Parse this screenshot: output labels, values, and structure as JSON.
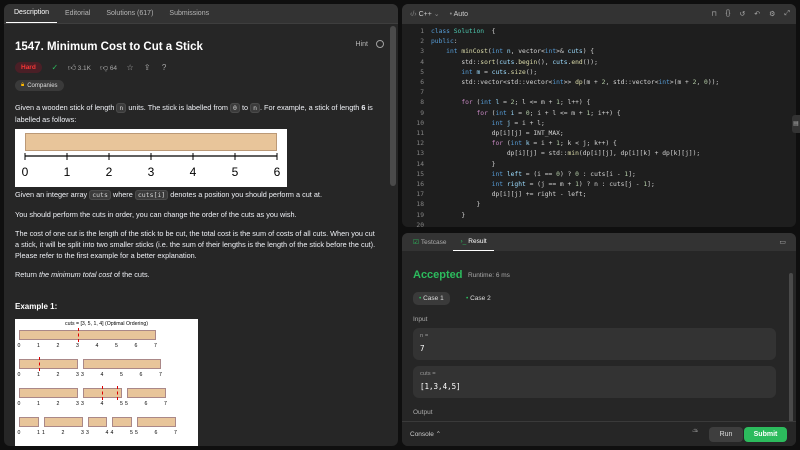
{
  "tabs": [
    "Description",
    "Editorial",
    "Solutions (617)",
    "Submissions"
  ],
  "problem": {
    "title": "1547. Minimum Cost to Cut a Stick",
    "hint": "Hint",
    "difficulty": "Hard",
    "likes": "3.1K",
    "dislikes": "64",
    "companies": "Companies",
    "p1a": "Given a wooden stick of length ",
    "p1n": "n",
    "p1b": " units. The stick is labelled from ",
    "p1z": "0",
    "p1c": " to ",
    "p1n2": "n",
    "p1d": ". For example, a stick of length ",
    "p1six": "6",
    "p1e": " is labelled as follows:",
    "p2a": "Given an integer array ",
    "p2cuts": "cuts",
    "p2b": " where ",
    "p2ci": "cuts[i]",
    "p2c": " denotes a position you should perform a cut at.",
    "p3": "You should perform the cuts in order, you can change the order of the cuts as you wish.",
    "p4": "The cost of one cut is the length of the stick to be cut, the total cost is the sum of costs of all cuts. When you cut a stick, it will be split into two smaller sticks (i.e. the sum of their lengths is the length of the stick before the cut). Please refer to the first example for a better explanation.",
    "p5a": "Return ",
    "p5b": "the minimum total cost",
    "p5c": " of the cuts.",
    "example": "Example 1:",
    "stick_labels": [
      "0",
      "1",
      "2",
      "3",
      "4",
      "5",
      "6"
    ],
    "ex_caption": "cuts = [3, 5, 1, 4] (Optimal Ordering)",
    "ex_labels": [
      "0",
      "1",
      "2",
      "3",
      "4",
      "5",
      "6",
      "7"
    ]
  },
  "editor": {
    "language": "C++",
    "mode": "Auto",
    "lines": [
      [
        [
          "kw",
          "class "
        ],
        [
          "ty",
          "Solution"
        ],
        [
          "",
          "  {"
        ]
      ],
      [
        [
          "kw",
          "public"
        ],
        [
          "",
          ":"
        ]
      ],
      [
        [
          "",
          "    "
        ],
        [
          "kw",
          "int "
        ],
        [
          "fn",
          "minCost"
        ],
        [
          "",
          "("
        ],
        [
          "kw",
          "int "
        ],
        [
          "vr",
          "n"
        ],
        [
          "",
          ", vector<"
        ],
        [
          "kw",
          "int"
        ],
        [
          "",
          ">& "
        ],
        [
          "vr",
          "cuts"
        ],
        [
          "",
          ") {"
        ]
      ],
      [
        [
          "",
          "        std::"
        ],
        [
          "fn",
          "sort"
        ],
        [
          "",
          "("
        ],
        [
          "vr",
          "cuts"
        ],
        [
          "",
          "."
        ],
        [
          "fn",
          "begin"
        ],
        [
          "",
          "(), "
        ],
        [
          "vr",
          "cuts"
        ],
        [
          "",
          "."
        ],
        [
          "fn",
          "end"
        ],
        [
          "",
          "());"
        ]
      ],
      [
        [
          "",
          "        "
        ],
        [
          "kw",
          "int "
        ],
        [
          "vr",
          "m"
        ],
        [
          "",
          " = "
        ],
        [
          "vr",
          "cuts"
        ],
        [
          "",
          "."
        ],
        [
          "fn",
          "size"
        ],
        [
          "",
          "();"
        ]
      ],
      [
        [
          "",
          "        std::vector<std::vector<"
        ],
        [
          "kw",
          "int"
        ],
        [
          "",
          ">> "
        ],
        [
          "fn",
          "dp"
        ],
        [
          "",
          "(m + "
        ],
        [
          "nm",
          "2"
        ],
        [
          "",
          ", std::vector<"
        ],
        [
          "kw",
          "int"
        ],
        [
          "",
          ">(m + "
        ],
        [
          "nm",
          "2"
        ],
        [
          "",
          ", "
        ],
        [
          "nm",
          "0"
        ],
        [
          "",
          "));"
        ]
      ],
      [
        [
          "",
          ""
        ]
      ],
      [
        [
          "",
          "        "
        ],
        [
          "ct",
          "for "
        ],
        [
          "",
          "("
        ],
        [
          "kw",
          "int "
        ],
        [
          "vr",
          "l"
        ],
        [
          "",
          "",
          " = "
        ],
        [
          "nm",
          "2"
        ],
        [
          "",
          "; l <= m + "
        ],
        [
          "nm",
          "1"
        ],
        [
          "",
          "; l++) {"
        ]
      ],
      [
        [
          "",
          "            "
        ],
        [
          "ct",
          "for "
        ],
        [
          "",
          "("
        ],
        [
          "kw",
          "int "
        ],
        [
          "vr",
          "i"
        ],
        [
          "",
          "",
          " = "
        ],
        [
          "nm",
          "0"
        ],
        [
          "",
          "; i + l <= m + "
        ],
        [
          "nm",
          "1"
        ],
        [
          "",
          "; i++) {"
        ]
      ],
      [
        [
          "",
          "                "
        ],
        [
          "kw",
          "int "
        ],
        [
          "vr",
          "j"
        ],
        [
          "",
          "",
          " = i + l;"
        ]
      ],
      [
        [
          "",
          "                dp[i][j] = INT_MAX;"
        ]
      ],
      [
        [
          "",
          "                "
        ],
        [
          "ct",
          "for "
        ],
        [
          "",
          "("
        ],
        [
          "kw",
          "int "
        ],
        [
          "vr",
          "k"
        ],
        [
          "",
          "",
          " = i + "
        ],
        [
          "nm",
          "1"
        ],
        [
          "",
          "; k < j; k++) {"
        ]
      ],
      [
        [
          "",
          "                    dp[i][j] = std::"
        ],
        [
          "fn",
          "min"
        ],
        [
          "",
          "(dp[i][j], dp[i][k] + dp[k][j]);"
        ]
      ],
      [
        [
          "",
          "                }"
        ]
      ],
      [
        [
          "",
          "                "
        ],
        [
          "kw",
          "int "
        ],
        [
          "vr",
          "left"
        ],
        [
          "",
          "",
          " = (i == "
        ],
        [
          "nm",
          "0"
        ],
        [
          "",
          ") ? "
        ],
        [
          "nm",
          "0"
        ],
        [
          "",
          " : cuts[i - "
        ],
        [
          "nm",
          "1"
        ],
        [
          "",
          "];"
        ]
      ],
      [
        [
          "",
          "                "
        ],
        [
          "kw",
          "int "
        ],
        [
          "vr",
          "right"
        ],
        [
          "",
          "",
          " = (j == m + "
        ],
        [
          "nm",
          "1"
        ],
        [
          "",
          ") ? n : cuts[j - "
        ],
        [
          "nm",
          "1"
        ],
        [
          "",
          "];"
        ]
      ],
      [
        [
          "",
          "                dp[i][j] += right - left;"
        ]
      ],
      [
        [
          "",
          "            }"
        ]
      ],
      [
        [
          "",
          "        }"
        ]
      ],
      [
        [
          "",
          ""
        ]
      ],
      [
        [
          "",
          "        "
        ],
        [
          "ct",
          "return "
        ],
        [
          "",
          "dp["
        ],
        [
          "nm",
          "0"
        ],
        [
          "",
          "][m + "
        ],
        [
          "nm",
          "1"
        ],
        [
          "",
          "];"
        ]
      ]
    ]
  },
  "result": {
    "tabs": [
      "Testcase",
      "Result"
    ],
    "status": "Accepted",
    "runtime": "Runtime: 6 ms",
    "case1": "Case 1",
    "case2": "Case 2",
    "input_label": "Input",
    "n_label": "n =",
    "n_value": "7",
    "cuts_label": "cuts =",
    "cuts_value": "[1,3,4,5]",
    "output_label": "Output",
    "console": "Console",
    "run": "Run",
    "submit": "Submit"
  },
  "colors": {
    "accepted": "#2cbb5d",
    "hard": "#f63636",
    "submit": "#2cbb5d"
  }
}
